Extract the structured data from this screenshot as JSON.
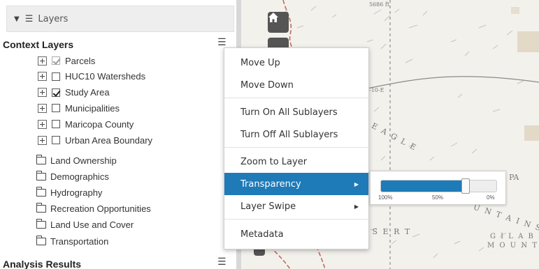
{
  "panel": {
    "header_title": "Layers",
    "context_title": "Context Layers",
    "analysis_title": "Analysis Results",
    "context_layers": [
      {
        "label": "Parcels",
        "checked": true,
        "dim": true
      },
      {
        "label": "HUC10 Watersheds",
        "checked": false,
        "dim": false
      },
      {
        "label": "Study Area",
        "checked": true,
        "dim": false
      },
      {
        "label": "Municipalities",
        "checked": false,
        "dim": false
      },
      {
        "label": "Maricopa County",
        "checked": false,
        "dim": false
      },
      {
        "label": "Urban Area Boundary",
        "checked": false,
        "dim": false
      }
    ],
    "folders": [
      {
        "label": "Land Ownership"
      },
      {
        "label": "Demographics"
      },
      {
        "label": "Hydrography"
      },
      {
        "label": "Recreation Opportunities"
      },
      {
        "label": "Land Use and Cover"
      },
      {
        "label": "Transportation"
      }
    ]
  },
  "menu": {
    "items": [
      {
        "label": "Move Up"
      },
      {
        "label": "Move Down"
      },
      {
        "label": "Turn On All Sublayers"
      },
      {
        "label": "Turn Off All Sublayers"
      },
      {
        "label": "Zoom to Layer"
      },
      {
        "label": "Transparency"
      },
      {
        "label": "Layer Swipe"
      },
      {
        "label": "Metadata"
      }
    ]
  },
  "slider": {
    "value_fraction": 0.73,
    "ticks": [
      "100%",
      "50%",
      "0%"
    ]
  },
  "map": {
    "labels": {
      "elevation": "5686 ft",
      "road": "-10-E",
      "eagle": "E A G L E",
      "pa": "PA",
      "desert": "E S E R T",
      "mountains": "U N T A I N S",
      "gila": "G I L A  B E N",
      "mountai": "M O U N T A I"
    }
  },
  "colors": {
    "accent": "#1f7ab8",
    "map_bg": "#f3f1ec",
    "map_button": "#555555"
  }
}
